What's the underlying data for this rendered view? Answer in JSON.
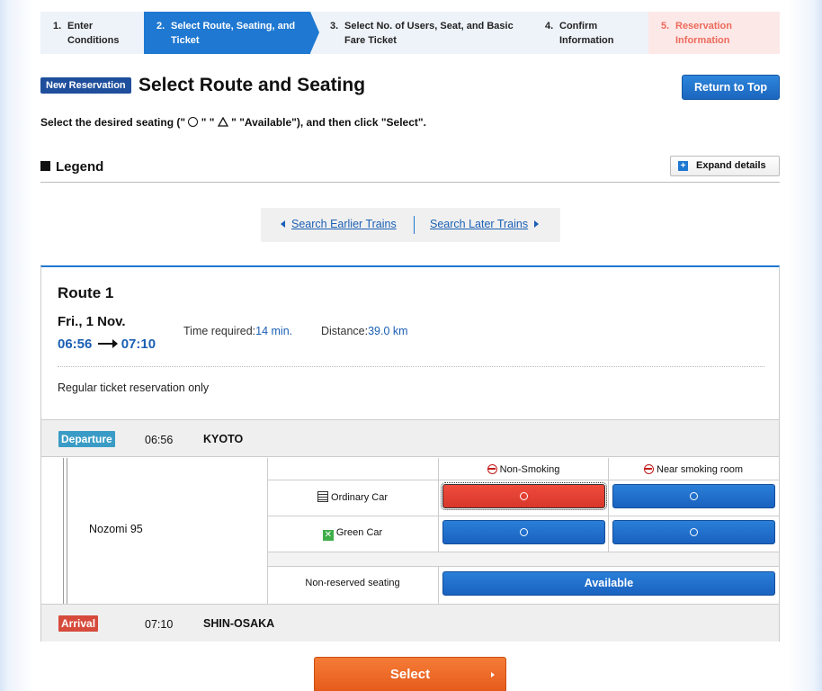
{
  "steps": [
    {
      "num": "1.",
      "label": "Enter Conditions"
    },
    {
      "num": "2.",
      "label": "Select Route, Seating, and Ticket"
    },
    {
      "num": "3.",
      "label": "Select No. of Users, Seat, and Basic Fare Ticket"
    },
    {
      "num": "4.",
      "label": "Confirm Information"
    },
    {
      "num": "5.",
      "label": "Reservation Information"
    }
  ],
  "header": {
    "badge": "New Reservation",
    "title": "Select Route and Seating",
    "return_top": "Return to Top"
  },
  "instruction": {
    "prefix": "Select the desired seating (\"",
    "mid": "\" \"",
    "suffix": "\" \"Available\"), and then click \"Select\"."
  },
  "legend": {
    "title": "Legend",
    "expand": "Expand details"
  },
  "search": {
    "earlier": "Search Earlier Trains",
    "later": "Search Later Trains"
  },
  "route": {
    "title": "Route 1",
    "date": "Fri., 1 Nov.",
    "depart_time": "06:56",
    "arrive_time": "07:10",
    "time_required_label": "Time required:",
    "time_required": "14 min.",
    "distance_label": "Distance:",
    "distance": "39.0 km",
    "note": "Regular ticket reservation only",
    "departure": {
      "tag": "Departure",
      "time": "06:56",
      "station": "KYOTO"
    },
    "arrival": {
      "tag": "Arrival",
      "time": "07:10",
      "station": "SHIN-OSAKA"
    },
    "train": "Nozomi 95",
    "columns": [
      "Non-Smoking",
      "Near smoking room"
    ],
    "classes": {
      "ordinary": "Ordinary Car",
      "green": "Green Car",
      "non_reserved": "Non-reserved seating"
    },
    "available": "Available"
  },
  "select_button": "Select",
  "colors": {
    "accent": "#1f78d1",
    "selected": "#e5412f",
    "select_button": "#ef6a28"
  }
}
